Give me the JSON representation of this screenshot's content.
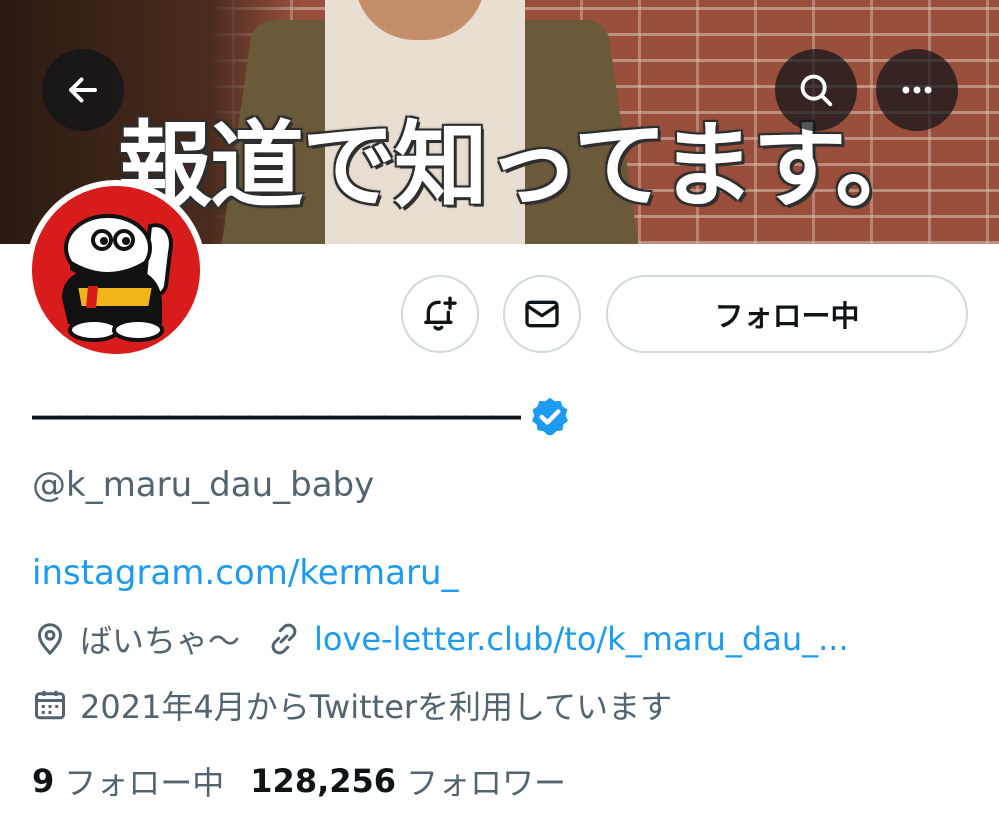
{
  "banner": {
    "caption": "報道で知ってます。"
  },
  "header_icons": {
    "back": "arrow-left-icon",
    "search": "search-icon",
    "more": "more-horizontal-icon"
  },
  "actions": {
    "notify_icon": "bell-plus-icon",
    "message_icon": "envelope-icon",
    "follow_label": "フォロー中"
  },
  "profile": {
    "display_name": "――――――――――――――――――",
    "verified_icon": "verified-badge-icon",
    "handle": "@k_maru_dau_baby",
    "bio_link": "instagram.com/kermaru_",
    "location": "ばいちゃ〜",
    "website": "love-letter.club/to/k_maru_dau_...",
    "joined": "2021年4月からTwitterを利用しています"
  },
  "stats": {
    "following_count": "9",
    "following_label": "フォロー中",
    "followers_count": "128,256",
    "followers_label": "フォロワー"
  },
  "colors": {
    "accent": "#1d9bf0",
    "secondary_text": "#536471",
    "border": "#cfd9de",
    "avatar_red": "#d81b1b"
  }
}
